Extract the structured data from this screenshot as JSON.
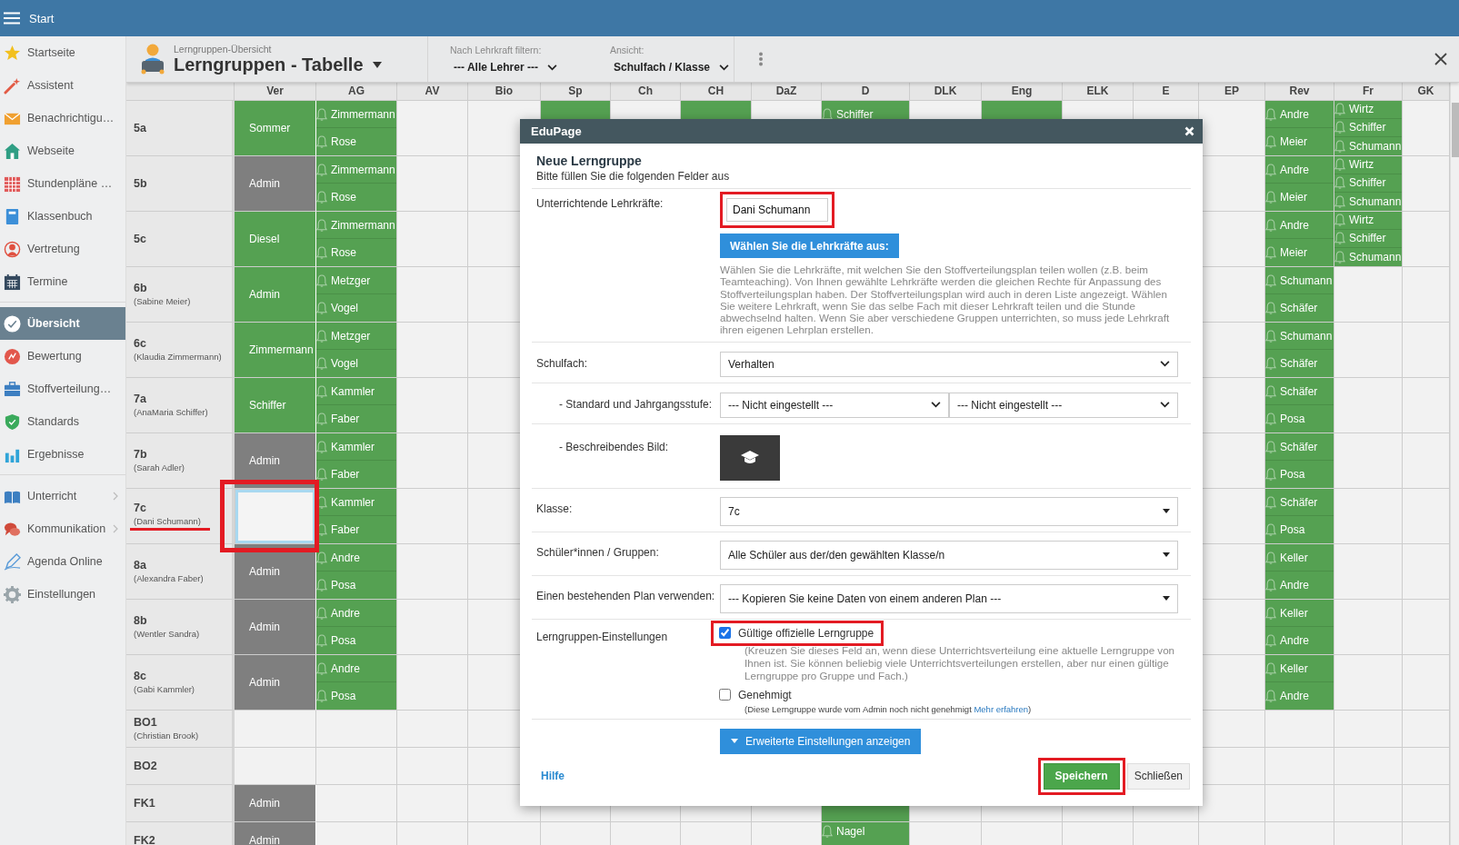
{
  "topbar": {
    "title": "Start"
  },
  "sidebar": {
    "groups": [
      {
        "items": [
          {
            "label": "Startseite",
            "selected": false,
            "has_submenu": false
          },
          {
            "label": "Assistent",
            "selected": false,
            "has_submenu": false
          },
          {
            "label": "Benachrichtigu…",
            "selected": false,
            "has_submenu": false
          },
          {
            "label": "Webseite",
            "selected": false,
            "has_submenu": false
          },
          {
            "label": "Stundenpläne …",
            "selected": false,
            "has_submenu": false
          },
          {
            "label": "Klassenbuch",
            "selected": false,
            "has_submenu": false
          },
          {
            "label": "Vertretung",
            "selected": false,
            "has_submenu": false
          },
          {
            "label": "Termine",
            "selected": false,
            "has_submenu": false
          }
        ]
      },
      {
        "items": [
          {
            "label": "Übersicht",
            "selected": true,
            "has_submenu": false
          },
          {
            "label": "Bewertung",
            "selected": false,
            "has_submenu": false
          },
          {
            "label": "Stoffverteilung…",
            "selected": false,
            "has_submenu": false
          },
          {
            "label": "Standards",
            "selected": false,
            "has_submenu": false
          },
          {
            "label": "Ergebnisse",
            "selected": false,
            "has_submenu": false
          }
        ]
      },
      {
        "items": [
          {
            "label": "Unterricht",
            "selected": false,
            "has_submenu": true
          },
          {
            "label": "Kommunikation",
            "selected": false,
            "has_submenu": true
          },
          {
            "label": "Agenda Online",
            "selected": false,
            "has_submenu": false
          },
          {
            "label": "Einstellungen",
            "selected": false,
            "has_submenu": false
          }
        ]
      }
    ]
  },
  "header": {
    "subtitle": "Lerngruppen-Übersicht",
    "title": "Lerngruppen - Tabelle",
    "filters": [
      {
        "label": "Nach Lehrkraft filtern:",
        "value": "--- Alle Lehrer ---"
      },
      {
        "label": "Ansicht:",
        "value": "Schulfach / Klasse"
      }
    ]
  },
  "table": {
    "columns": [
      "Ver",
      "AG",
      "AV",
      "Bio",
      "Sp",
      "Ch",
      "CH",
      "DaZ",
      "D",
      "DLK",
      "Eng",
      "ELK",
      "E",
      "EP",
      "Rev",
      "Fr",
      "GK"
    ],
    "rows": [
      {
        "label": "5a",
        "cells": [
          {
            "kind": "teacher",
            "text": "Sommer",
            "color": "#55a152"
          },
          {
            "kind": "names",
            "names": [
              "Zimmermann",
              "Rose"
            ]
          },
          null,
          null,
          {
            "kind": "fill"
          },
          null,
          {
            "kind": "fill"
          },
          null,
          {
            "kind": "names",
            "names": [
              "Schiffer"
            ]
          },
          null,
          {
            "kind": "fill"
          },
          null,
          null,
          null,
          {
            "kind": "names",
            "names": [
              "Andre",
              "Meier"
            ]
          },
          {
            "kind": "names",
            "names": [
              "Wirtz",
              "Schiffer",
              "Schumann"
            ]
          },
          null
        ]
      },
      {
        "label": "5b",
        "cells": [
          {
            "kind": "teacher",
            "text": "Admin",
            "color": "#7f7f7f"
          },
          {
            "kind": "names",
            "names": [
              "Zimmermann",
              "Rose"
            ]
          },
          null,
          null,
          null,
          null,
          null,
          null,
          null,
          null,
          null,
          null,
          null,
          null,
          {
            "kind": "names",
            "names": [
              "Andre",
              "Meier"
            ]
          },
          {
            "kind": "names",
            "names": [
              "Wirtz",
              "Schiffer",
              "Schumann"
            ]
          },
          null
        ]
      },
      {
        "label": "5c",
        "cells": [
          {
            "kind": "teacher",
            "text": "Diesel",
            "color": "#55a152"
          },
          {
            "kind": "names",
            "names": [
              "Zimmermann",
              "Rose"
            ]
          },
          null,
          null,
          null,
          null,
          null,
          null,
          null,
          null,
          null,
          null,
          null,
          null,
          {
            "kind": "names",
            "names": [
              "Andre",
              "Meier"
            ]
          },
          {
            "kind": "names",
            "names": [
              "Wirtz",
              "Schiffer",
              "Schumann"
            ]
          },
          null
        ]
      },
      {
        "label": "6b",
        "teacher": "(Sabine Meier)",
        "underlined": false,
        "cells": [
          {
            "kind": "teacher",
            "text": "Admin",
            "color": "#55a152"
          },
          {
            "kind": "names",
            "names": [
              "Metzger",
              "Vogel"
            ]
          },
          null,
          null,
          null,
          null,
          null,
          null,
          null,
          null,
          null,
          null,
          null,
          null,
          {
            "kind": "names",
            "names": [
              "Schumann",
              "Schäfer"
            ]
          },
          null,
          null
        ]
      },
      {
        "label": "6c",
        "teacher": "(Klaudia Zimmermann)",
        "underlined": false,
        "cells": [
          {
            "kind": "teacher",
            "text": "Zimmermann",
            "color": "#55a152"
          },
          {
            "kind": "names",
            "names": [
              "Metzger",
              "Vogel"
            ]
          },
          null,
          null,
          null,
          null,
          null,
          null,
          null,
          null,
          null,
          null,
          null,
          null,
          {
            "kind": "names",
            "names": [
              "Schumann",
              "Schäfer"
            ]
          },
          null,
          null
        ]
      },
      {
        "label": "7a",
        "teacher": "(AnaMaria Schiffer)",
        "underlined": false,
        "cells": [
          {
            "kind": "teacher",
            "text": "Schiffer",
            "color": "#55a152"
          },
          {
            "kind": "names",
            "names": [
              "Kammler",
              "Faber"
            ]
          },
          null,
          null,
          null,
          null,
          null,
          null,
          null,
          null,
          null,
          null,
          null,
          null,
          {
            "kind": "names",
            "names": [
              "Schäfer",
              "Posa"
            ]
          },
          null,
          null
        ]
      },
      {
        "label": "7b",
        "teacher": "(Sarah Adler)",
        "underlined": false,
        "cells": [
          {
            "kind": "teacher",
            "text": "Admin",
            "color": "#7f7f7f"
          },
          {
            "kind": "names",
            "names": [
              "Kammler",
              "Faber"
            ]
          },
          null,
          null,
          null,
          null,
          null,
          null,
          null,
          null,
          null,
          null,
          null,
          null,
          {
            "kind": "names",
            "names": [
              "Schäfer",
              "Posa"
            ]
          },
          null,
          null
        ]
      },
      {
        "label": "7c",
        "teacher": "(Dani Schumann)",
        "underlined": true,
        "cells": [
          {
            "kind": "slot",
            "selected": true,
            "highlighted": true
          },
          {
            "kind": "names",
            "names": [
              "Kammler",
              "Faber"
            ]
          },
          null,
          null,
          null,
          null,
          null,
          null,
          null,
          null,
          null,
          null,
          null,
          null,
          {
            "kind": "names",
            "names": [
              "Schäfer",
              "Posa"
            ]
          },
          null,
          null
        ]
      },
      {
        "label": "8a",
        "teacher": "(Alexandra Faber)",
        "underlined": false,
        "cells": [
          {
            "kind": "teacher",
            "text": "Admin",
            "color": "#7f7f7f"
          },
          {
            "kind": "names",
            "names": [
              "Andre",
              "Posa"
            ]
          },
          null,
          null,
          null,
          null,
          null,
          null,
          null,
          null,
          null,
          null,
          null,
          null,
          {
            "kind": "names",
            "names": [
              "Keller",
              "Andre"
            ]
          },
          null,
          null
        ]
      },
      {
        "label": "8b",
        "teacher": "(Wentler Sandra)",
        "underlined": false,
        "cells": [
          {
            "kind": "teacher",
            "text": "Admin",
            "color": "#7f7f7f"
          },
          {
            "kind": "names",
            "names": [
              "Andre",
              "Posa"
            ]
          },
          null,
          null,
          null,
          null,
          null,
          null,
          null,
          null,
          null,
          null,
          null,
          null,
          {
            "kind": "names",
            "names": [
              "Keller",
              "Andre"
            ]
          },
          null,
          null
        ]
      },
      {
        "label": "8c",
        "teacher": "(Gabi Kammler)",
        "underlined": false,
        "cells": [
          {
            "kind": "teacher",
            "text": "Admin",
            "color": "#7f7f7f"
          },
          {
            "kind": "names",
            "names": [
              "Andre",
              "Posa"
            ]
          },
          null,
          null,
          null,
          null,
          null,
          null,
          null,
          null,
          null,
          null,
          null,
          null,
          {
            "kind": "names",
            "names": [
              "Keller",
              "Andre"
            ]
          },
          null,
          null
        ]
      },
      {
        "label": "BO1",
        "teacher": "(Christian Brook)",
        "underlined": false,
        "cells": [
          null,
          null,
          null,
          null,
          null,
          null,
          null,
          null,
          null,
          null,
          null,
          null,
          null,
          null,
          null,
          null,
          null
        ]
      },
      {
        "label": "BO2",
        "cells": [
          null,
          null,
          null,
          null,
          null,
          null,
          null,
          null,
          null,
          null,
          null,
          null,
          null,
          null,
          null,
          null,
          null
        ]
      },
      {
        "label": "FK1",
        "cells": [
          {
            "kind": "teacher",
            "text": "Admin",
            "color": "#7f7f7f"
          },
          null,
          null,
          null,
          null,
          null,
          null,
          null,
          {
            "kind": "fill"
          },
          null,
          null,
          null,
          null,
          null,
          null,
          null,
          null
        ]
      },
      {
        "label": "FK2",
        "cells": [
          {
            "kind": "teacher",
            "text": "Admin",
            "color": "#7f7f7f"
          },
          null,
          null,
          null,
          null,
          null,
          null,
          null,
          {
            "kind": "names",
            "names": [
              "Nagel"
            ]
          },
          null,
          null,
          null,
          null,
          null,
          null,
          null,
          null
        ]
      }
    ]
  },
  "dialog": {
    "title": "EduPage",
    "heading": "Neue Lerngruppe",
    "subheading": "Bitte füllen Sie die folgenden Felder aus",
    "fields": [
      {
        "kind": "teachers",
        "label": "Unterrichtende Lehrkräfte:",
        "value": "Dani Schumann",
        "highlighted": true,
        "button": "Wählen Sie die Lehrkräfte aus:",
        "help": "Wählen Sie die Lehrkräfte, mit welchen Sie den Stoffverteilungsplan teilen wollen (z.B. beim Teamteaching). Von Ihnen gewählte Lehrkräfte werden die gleichen Rechte für Anpassung des Stoffverteilungsplan haben. Der Stoffverteilungsplan wird auch in deren Liste angezeigt. Wählen Sie weitere Lehrkraft, wenn Sie das selbe Fach mit dieser Lehrkraft teilen und die Stunde abwechselnd halten. Wenn Sie aber verschiedene Gruppen unterrichten, so muss jede Lehrkraft ihren eigenen Lehrplan erstellen."
      },
      {
        "kind": "select",
        "label": "Schulfach:",
        "selects": [
          {
            "value": "Verhalten",
            "kind": "chevron"
          }
        ],
        "children": [
          {
            "kind": "select",
            "label": "- Standard und Jahrgangsstufe:",
            "selects": [
              {
                "value": "--- Nicht eingestellt ---",
                "kind": "chevron"
              },
              {
                "value": "--- Nicht eingestellt ---",
                "kind": "chevron"
              }
            ]
          },
          {
            "kind": "image",
            "label": "- Beschreibendes Bild:"
          }
        ]
      },
      {
        "kind": "select",
        "label": "Klasse:",
        "selects": [
          {
            "value": "7c",
            "kind": "triangle"
          }
        ]
      },
      {
        "kind": "select",
        "label": "Schüler*innen / Gruppen:",
        "selects": [
          {
            "value": "Alle Schüler aus der/den gewählten Klasse/n",
            "kind": "triangle"
          }
        ]
      },
      {
        "kind": "select",
        "label": "Einen bestehenden Plan verwenden:",
        "selects": [
          {
            "value": "--- Kopieren Sie keine Daten von einem anderen Plan ---",
            "kind": "triangle"
          }
        ]
      },
      {
        "kind": "settings",
        "label": "Lerngruppen-Einstellungen",
        "options": [
          {
            "label": "Gültige offizielle Lerngruppe",
            "checked": true,
            "highlighted": true,
            "note": "(Kreuzen Sie dieses Feld an, wenn diese Unterrichtsverteilung eine aktuelle Lerngruppe von Ihnen ist. Sie können beliebig viele Unterrichtsverteilungen erstellen, aber nur einen gültige Lerngruppe pro Gruppe und Fach.)"
          },
          {
            "label": "Genehmigt",
            "checked": false,
            "highlighted": false,
            "note": "(Diese Lerngruppe wurde vom Admin noch nicht genehmigt",
            "link": "Mehr erfahren",
            "note_end": ")"
          }
        ]
      }
    ],
    "advanced_button": "Erweiterte Einstellungen anzeigen",
    "help_link": "Hilfe",
    "buttons": [
      {
        "label": "Speichern",
        "kind": "primary",
        "highlighted": true
      },
      {
        "label": "Schließen",
        "kind": "secondary",
        "highlighted": false
      }
    ]
  }
}
